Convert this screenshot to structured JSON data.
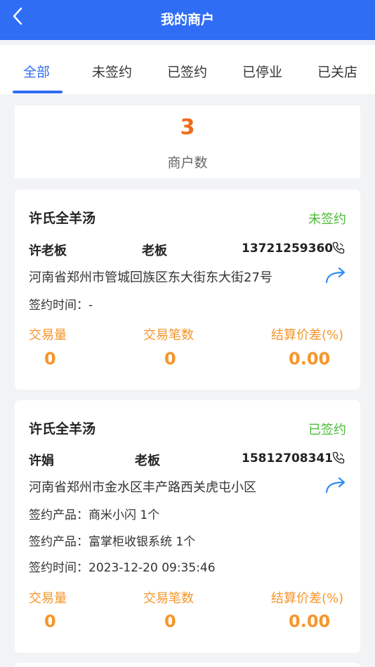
{
  "header": {
    "title": "我的商户"
  },
  "tabs": [
    {
      "label": "全部",
      "active": true
    },
    {
      "label": "未签约",
      "active": false
    },
    {
      "label": "已签约",
      "active": false
    },
    {
      "label": "已停业",
      "active": false
    },
    {
      "label": "已关店",
      "active": false
    }
  ],
  "summary": {
    "count": "3",
    "label": "商户数"
  },
  "merchants": [
    {
      "name": "许氏全羊汤",
      "status": "未签约",
      "status_color": "#4cbc36",
      "contact": "许老板",
      "role": "老板",
      "phone": "13721259360",
      "address": "河南省郑州市管城回族区东大街东大街27号",
      "lines": [
        "签约时间：-"
      ],
      "stats": [
        {
          "label": "交易量",
          "value": "0"
        },
        {
          "label": "交易笔数",
          "value": "0"
        },
        {
          "label": "结算价差(%)",
          "value": "0.00"
        }
      ]
    },
    {
      "name": "许氏全羊汤",
      "status": "已签约",
      "status_color": "#4cbc36",
      "contact": "许娟",
      "role": "老板",
      "phone": "15812708341",
      "address": "河南省郑州市金水区丰产路西关虎屯小区",
      "lines": [
        "签约产品：商米小闪 1个",
        "签约产品：富掌柜收银系统 1个",
        "签约时间：2023-12-20 09:35:46"
      ],
      "stats": [
        {
          "label": "交易量",
          "value": "0"
        },
        {
          "label": "交易笔数",
          "value": "0"
        },
        {
          "label": "结算价差(%)",
          "value": "0.00"
        }
      ]
    }
  ],
  "icons": {
    "back": "back-arrow-icon",
    "phone": "phone-icon",
    "share": "share-arrow-icon"
  },
  "colors": {
    "primary": "#2f6df5",
    "accent_orange": "#f26b1d",
    "stat_orange": "#f5962a",
    "status_green": "#4cbc36"
  }
}
